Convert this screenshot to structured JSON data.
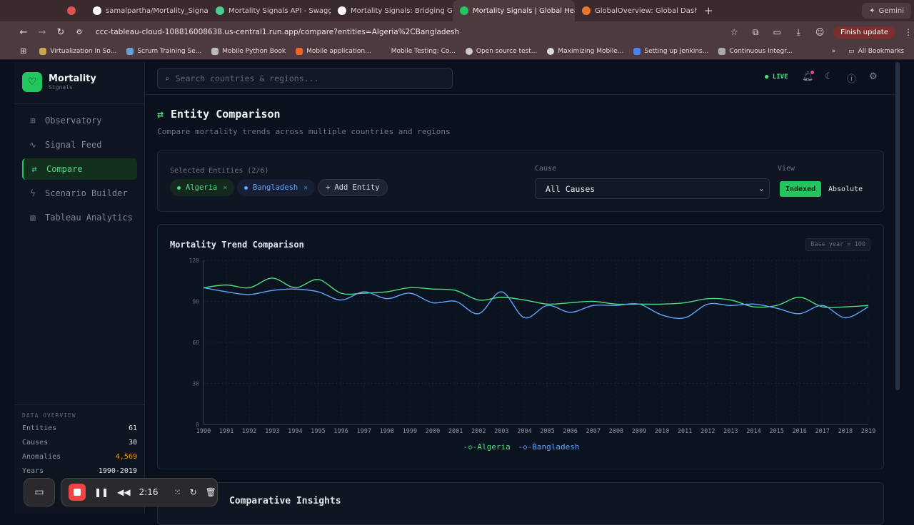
{
  "browser": {
    "tabs": [
      {
        "label": "",
        "icon": "record-icon"
      },
      {
        "label": "samalpartha/Mortality_Signal",
        "icon": "github-icon"
      },
      {
        "label": "Mortality Signals API - Swagg",
        "icon": "swagger-icon"
      },
      {
        "label": "Mortality Signals: Bridging G",
        "icon": "github-icon"
      },
      {
        "label": "Mortality Signals | Global Hea",
        "icon": "app-icon"
      },
      {
        "label": "GlobalOverview: Global Dash",
        "icon": "tableau-icon"
      }
    ],
    "gemini_label": "Gemini",
    "url": "ccc-tableau-cloud-108816008638.us-central1.run.app/compare?entities=Algeria%2CBangladesh",
    "finish_update": "Finish update",
    "bookmarks": [
      "Virtualization In So...",
      "Scrum Training Se...",
      "Mobile Python Book",
      "Mobile application...",
      "Mobile Testing: Co...",
      "Open source test...",
      "Maximizing Mobile...",
      "Setting up Jenkins...",
      "Continuous Integr..."
    ],
    "all_bookmarks": "All Bookmarks"
  },
  "brand": {
    "name": "Mortality",
    "sub": "Signals"
  },
  "nav": [
    {
      "label": "Observatory",
      "icon": "grid-icon"
    },
    {
      "label": "Signal Feed",
      "icon": "pulse-icon"
    },
    {
      "label": "Compare",
      "icon": "compare-icon"
    },
    {
      "label": "Scenario Builder",
      "icon": "bolt-icon"
    },
    {
      "label": "Tableau Analytics",
      "icon": "bar-chart-icon"
    }
  ],
  "overview": {
    "title": "DATA OVERVIEW",
    "rows": [
      {
        "label": "Entities",
        "value": "61"
      },
      {
        "label": "Causes",
        "value": "30"
      },
      {
        "label": "Anomalies",
        "value": "4,569"
      },
      {
        "label": "Years",
        "value": "1990-2019"
      }
    ]
  },
  "topbar": {
    "search_placeholder": "Search countries & regions...",
    "live": "LIVE"
  },
  "page": {
    "title": "Entity Comparison",
    "subtitle": "Compare mortality trends across multiple countries and regions"
  },
  "selection": {
    "label": "Selected Entities (2/6)",
    "entities": [
      "Algeria",
      "Bangladesh"
    ],
    "add_label": "Add Entity",
    "cause_label": "Cause",
    "cause_value": "All Causes",
    "view_label": "View",
    "view_indexed": "Indexed",
    "view_absolute": "Absolute"
  },
  "chart_card": {
    "title": "Mortality Trend Comparison",
    "badge": "Base year = 100"
  },
  "chart_data": {
    "type": "line",
    "x": [
      1990,
      1991,
      1992,
      1993,
      1994,
      1995,
      1996,
      1997,
      1998,
      1999,
      2000,
      2001,
      2002,
      2003,
      2004,
      2005,
      2006,
      2007,
      2008,
      2009,
      2010,
      2011,
      2012,
      2013,
      2014,
      2015,
      2016,
      2017,
      2018,
      2019
    ],
    "series": [
      {
        "name": "Algeria",
        "color": "#4ade80",
        "values": [
          100,
          102,
          100,
          107,
          100,
          106,
          96,
          96,
          97,
          100,
          99,
          98,
          91,
          93,
          91,
          88,
          89,
          90,
          88,
          88,
          88,
          89,
          92,
          91,
          86,
          87,
          93,
          86,
          86,
          87
        ]
      },
      {
        "name": "Bangladesh",
        "color": "#60a5fa",
        "values": [
          100,
          97,
          95,
          98,
          99,
          97,
          91,
          97,
          92,
          96,
          89,
          90,
          81,
          97,
          78,
          87,
          82,
          87,
          87,
          88,
          80,
          78,
          88,
          87,
          88,
          85,
          81,
          87,
          78,
          86
        ]
      }
    ],
    "ylim": [
      0,
      120
    ],
    "yticks": [
      0,
      30,
      60,
      90,
      120
    ],
    "grid": true,
    "legend": "bottom-center"
  },
  "insights": {
    "title": "Comparative Insights"
  },
  "recorder": {
    "time": "2:16"
  }
}
